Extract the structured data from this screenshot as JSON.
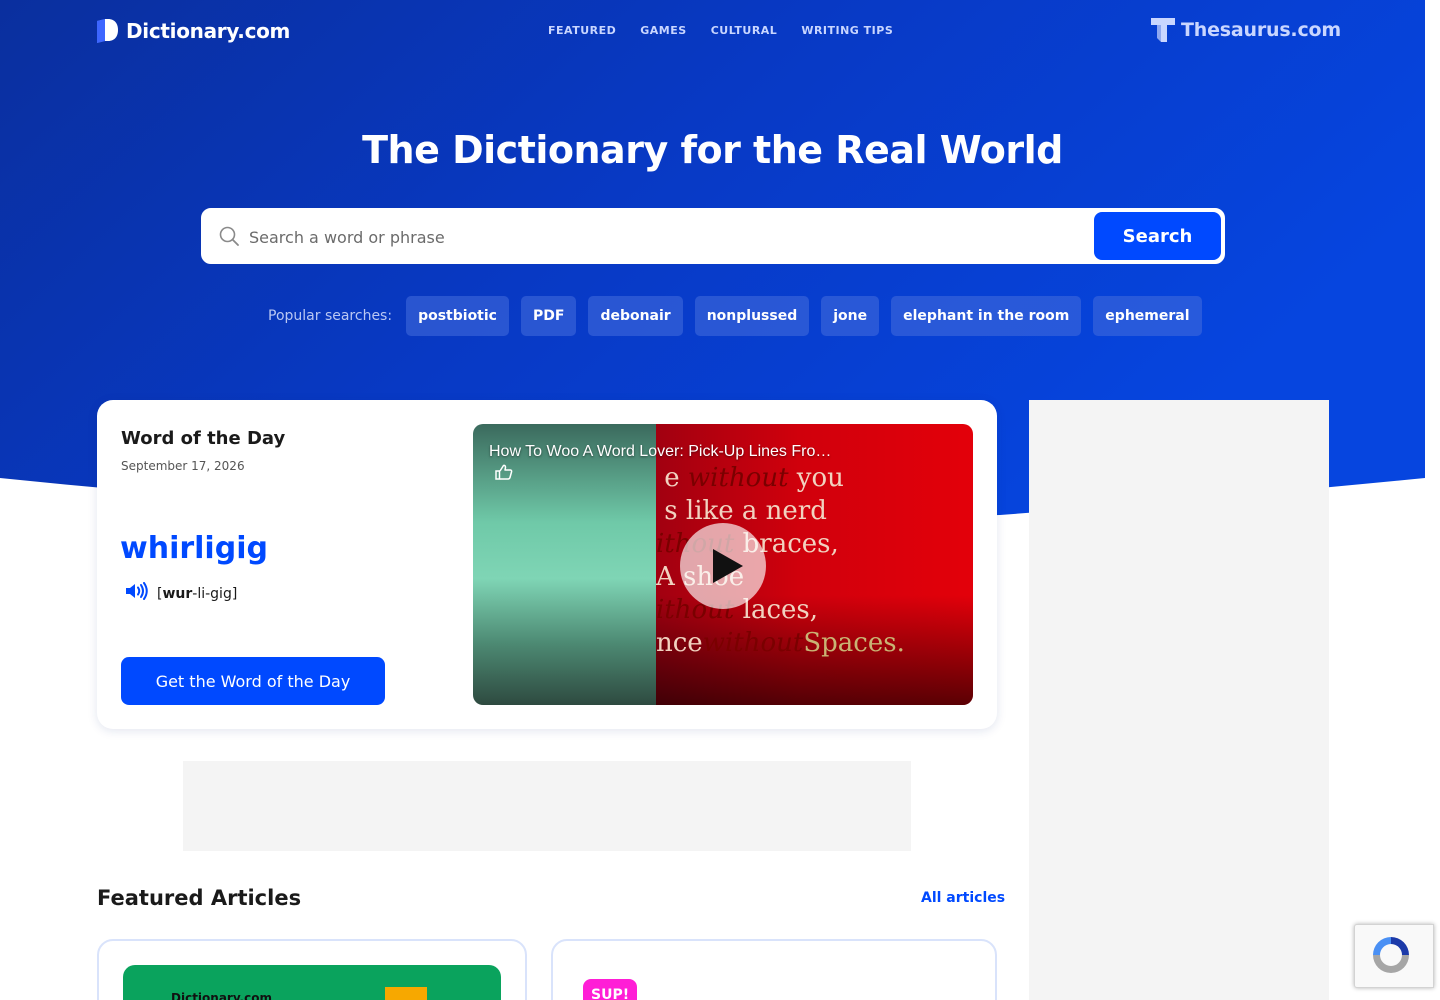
{
  "header": {
    "logo_text": "Dictionary.com",
    "nav": [
      "FEATURED",
      "GAMES",
      "CULTURAL",
      "WRITING TIPS"
    ],
    "thesaurus_text": "Thesaurus.com"
  },
  "hero": {
    "title": "The Dictionary for the Real World",
    "search": {
      "placeholder": "Search a word or phrase",
      "button_label": "Search"
    },
    "popular_label": "Popular searches:",
    "popular_searches": [
      "postbiotic",
      "PDF",
      "debonair",
      "nonplussed",
      "jone",
      "elephant in the room",
      "ephemeral"
    ]
  },
  "word_of_the_day": {
    "heading": "Word of the Day",
    "date": "September 17, 2026",
    "word": "whirligig",
    "pronunciation": {
      "open": "[",
      "stressed": "wur",
      "rest": "-li-gig",
      "close": "]"
    },
    "button_label": "Get the Word of the Day"
  },
  "video": {
    "title": "How To Woo A Word Lover: Pick-Up Lines Fro…",
    "lines": [
      {
        "a": "e ",
        "i": "without",
        "b": " you"
      },
      {
        "a": "s like a nerd",
        "i": "",
        "b": ""
      },
      {
        "a": "",
        "i": "ithout",
        "b": " braces,"
      },
      {
        "a": " A shoe",
        "i": "",
        "b": ""
      },
      {
        "a": "",
        "i": "ithout",
        "b": " laces,"
      },
      {
        "a": "nce",
        "i": "without",
        "b": "Spaces."
      }
    ]
  },
  "featured": {
    "title": "Featured Articles",
    "all_link": "All articles",
    "card1_logo": "Dictionary.com",
    "card2_badge": "SUP!"
  },
  "colors": {
    "brand_blue": "#0049ff",
    "hero_bg": "#0a3ccf"
  }
}
